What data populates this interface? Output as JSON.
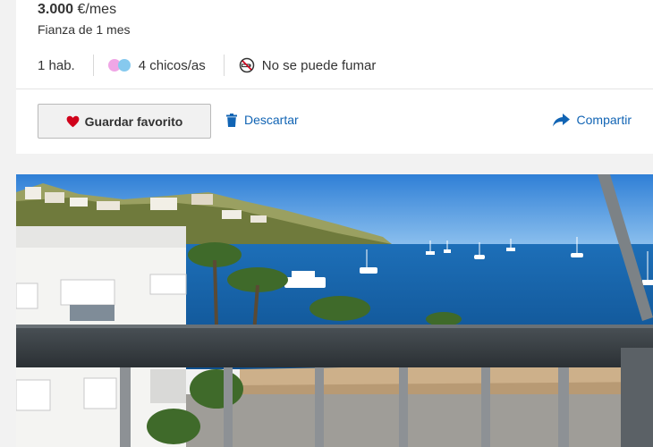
{
  "listing": {
    "price": "3.000",
    "price_unit": "€/mes",
    "deposit": "Fianza de 1 mes"
  },
  "features": {
    "rooms": "1 hab.",
    "roommates": "4 chicos/as",
    "smoking": "No se puede fumar"
  },
  "actions": {
    "favorite_label": "Guardar favorito",
    "discard_label": "Descartar",
    "share_label": "Compartir"
  },
  "icons": {
    "favorite": "heart-icon",
    "discard": "trash-icon",
    "share": "share-arrow-icon",
    "roommates": "gender-dots-icon",
    "smoking": "no-smoking-icon"
  },
  "colors": {
    "accent_link": "#1164b4",
    "heart": "#d0021b",
    "dot_pink": "#f0a6e6",
    "dot_blue": "#86c9ee"
  }
}
